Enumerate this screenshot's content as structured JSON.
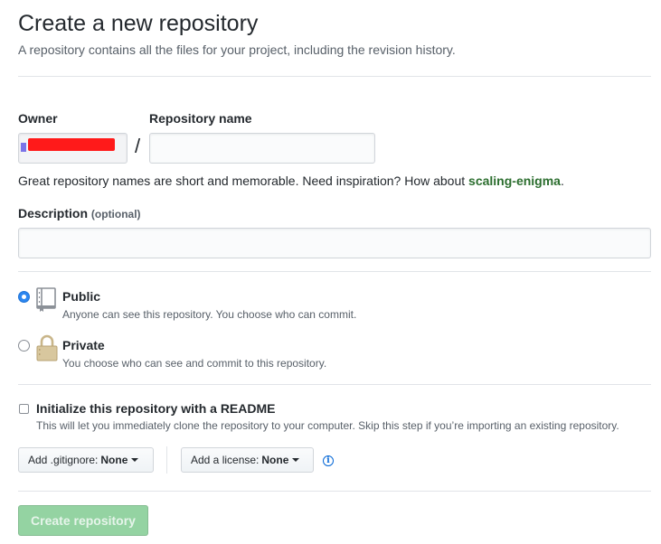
{
  "header": {
    "title": "Create a new repository",
    "subtitle": "A repository contains all the files for your project, including the revision history."
  },
  "owner": {
    "label": "Owner"
  },
  "repo_name": {
    "label": "Repository name",
    "separator": "/",
    "value": "",
    "placeholder": ""
  },
  "name_hint": {
    "prefix": "Great repository names are short and memorable. Need inspiration? How about ",
    "suggestion": "scaling-enigma",
    "suffix": "."
  },
  "description": {
    "label": "Description",
    "optional": "(optional)",
    "value": "",
    "placeholder": ""
  },
  "visibility": {
    "selected": "public",
    "public": {
      "title": "Public",
      "desc": "Anyone can see this repository. You choose who can commit."
    },
    "private": {
      "title": "Private",
      "desc": "You choose who can see and commit to this repository."
    }
  },
  "init": {
    "title": "Initialize this repository with a README",
    "desc": "This will let you immediately clone the repository to your computer. Skip this step if you’re importing an existing repository.",
    "checked": false
  },
  "gitignore": {
    "prefix": "Add .gitignore:",
    "value": "None"
  },
  "license": {
    "prefix": "Add a license:",
    "value": "None"
  },
  "submit": {
    "label": "Create repository"
  },
  "colors": {
    "suggestion": "#2c6e2f",
    "radio_selected": "#2c86f0",
    "submit_bg": "#94d3a2",
    "info": "#0366d6"
  },
  "icons": {
    "public": "repo-book-icon",
    "private": "lock-icon",
    "info": "info-icon",
    "caret": "caret-down-icon"
  }
}
